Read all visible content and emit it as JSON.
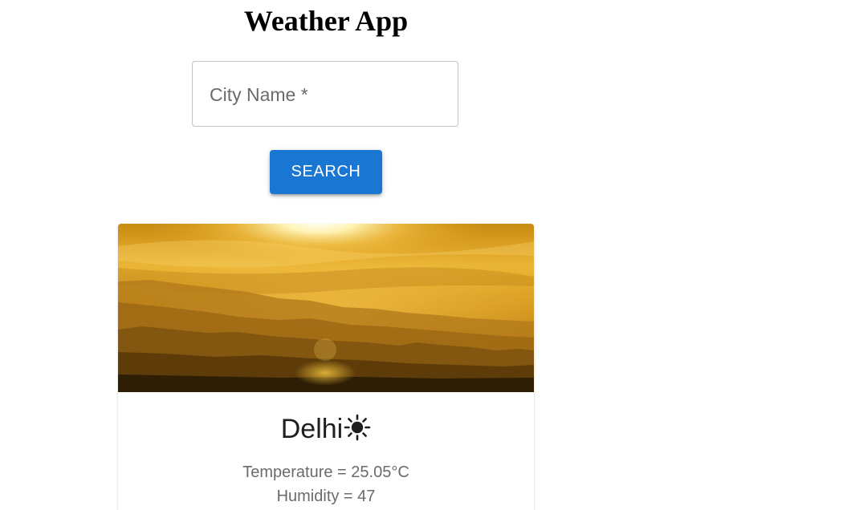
{
  "app": {
    "title": "Weather App"
  },
  "search": {
    "label": "City Name *",
    "value": "",
    "button_label": "SEARCH"
  },
  "weather": {
    "city": "Delhi",
    "condition_icon": "sun-icon",
    "temperature_text": "Temperature = 25.05°C",
    "humidity_text": "Humidity = 47"
  },
  "colors": {
    "primary": "#1976d2",
    "card_image_tone": "#e8a81c"
  }
}
